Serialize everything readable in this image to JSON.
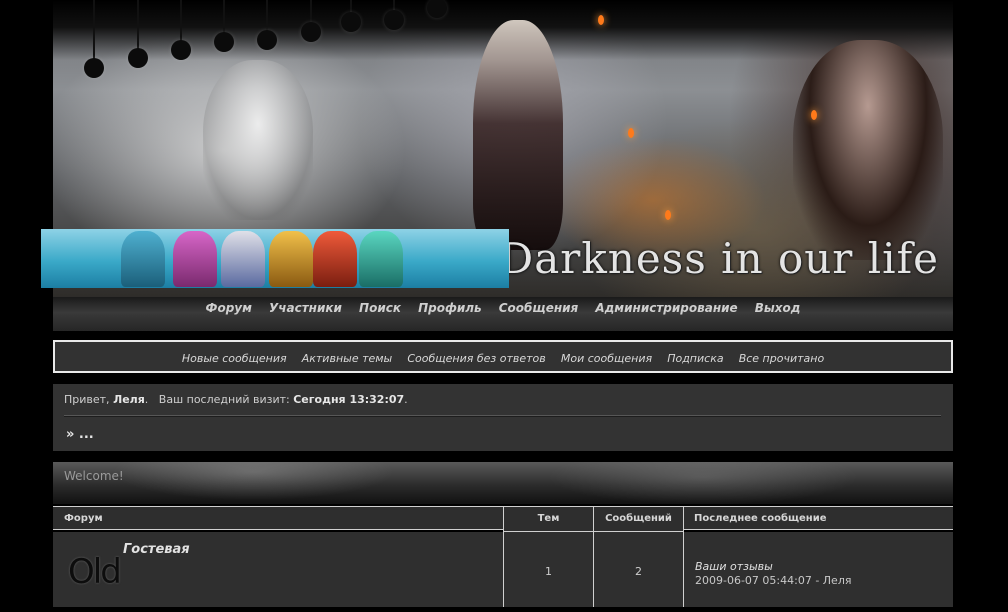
{
  "header": {
    "site_title": "Darkness in our life"
  },
  "main_nav": [
    "Форум",
    "Участники",
    "Поиск",
    "Профиль",
    "Сообщения",
    "Администрирование",
    "Выход"
  ],
  "sub_nav": [
    "Новые сообщения",
    "Активные темы",
    "Сообщения без ответов",
    "Мои сообщения",
    "Подписка",
    "Все прочитано"
  ],
  "welcome": {
    "greeting_prefix": "Привет,",
    "username": "Леля",
    "last_visit_label": "Ваш последний визит:",
    "last_visit_value": "Сегодня 13:32:07",
    "breadcrumb": "» ..."
  },
  "category": {
    "title": "Welcome!"
  },
  "table": {
    "headers": {
      "forum": "Форум",
      "topics": "Тем",
      "posts": "Сообщений",
      "last_post": "Последнее сообщение"
    },
    "rows": [
      {
        "logo_text": "Old",
        "name": "Гостевая",
        "topics": "1",
        "posts": "2",
        "last_post_topic": "Ваши отзывы",
        "last_post_meta": "2009-06-07 05:44:07 - Леля"
      }
    ]
  },
  "colors": {
    "page_bg": "#000000",
    "panel_bg": "#333333",
    "border": "#e9e9e9",
    "accent_spark": "#ff7a1a"
  }
}
